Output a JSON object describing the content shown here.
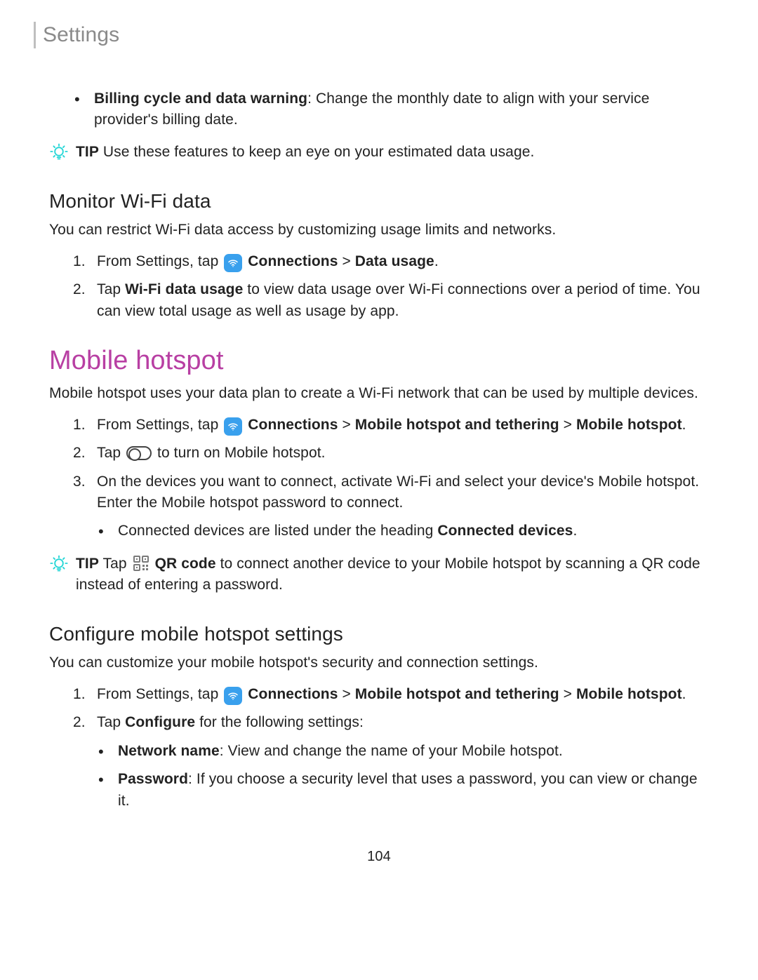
{
  "header": {
    "title": "Settings"
  },
  "billing_bullet": {
    "label": "Billing cycle and data warning",
    "text": ": Change the monthly date to align with your service provider's billing date."
  },
  "tip1": {
    "label": "TIP",
    "text": "Use these features to keep an eye on your estimated data usage."
  },
  "monitor": {
    "heading": "Monitor Wi-Fi data",
    "intro": "You can restrict Wi-Fi data access by customizing usage limits and networks.",
    "step1_pre": "From Settings, tap ",
    "step1_connections": "Connections",
    "step1_sep": " > ",
    "step1_data_usage": "Data usage",
    "step1_period": ".",
    "step2_pre": "Tap ",
    "step2_bold": "Wi-Fi data usage",
    "step2_post": " to view data usage over Wi-Fi connections over a period of time. You can view total usage as well as usage by app."
  },
  "hotspot": {
    "heading": "Mobile hotspot",
    "intro": "Mobile hotspot uses your data plan to create a Wi-Fi network that can be used by multiple devices.",
    "step1_pre": "From Settings, tap ",
    "step1_connections": "Connections",
    "step1_sep1": " > ",
    "step1_path2": "Mobile hotspot and tethering",
    "step1_sep2": " > ",
    "step1_path3": "Mobile hotspot",
    "step1_period": ".",
    "step2_pre": "Tap ",
    "step2_post": " to turn on Mobile hotspot.",
    "step3": "On the devices you want to connect, activate Wi-Fi and select your device's Mobile hotspot. Enter the Mobile hotspot password to connect.",
    "step3_sub_pre": "Connected devices are listed under the heading ",
    "step3_sub_bold": "Connected devices",
    "step3_sub_period": "."
  },
  "tip2": {
    "label": "TIP",
    "pre": "Tap ",
    "bold": "QR code",
    "post": " to connect another device to your Mobile hotspot by scanning a QR code instead of entering a password."
  },
  "configure": {
    "heading": "Configure mobile hotspot settings",
    "intro": "You can customize your mobile hotspot's security and connection settings.",
    "step1_pre": "From Settings, tap ",
    "step1_connections": "Connections",
    "step1_sep1": " > ",
    "step1_path2": "Mobile hotspot and tethering",
    "step1_sep2": " > ",
    "step1_path3": "Mobile hotspot",
    "step1_period": ".",
    "step2_pre": "Tap ",
    "step2_bold": "Configure",
    "step2_post": " for the following settings:",
    "sub1_label": "Network name",
    "sub1_text": ": View and change the name of your Mobile hotspot.",
    "sub2_label": "Password",
    "sub2_text": ": If you choose a security level that uses a password, you can view or change it."
  },
  "page_number": "104",
  "nums": {
    "n1": "1.",
    "n2": "2.",
    "n3": "3."
  }
}
